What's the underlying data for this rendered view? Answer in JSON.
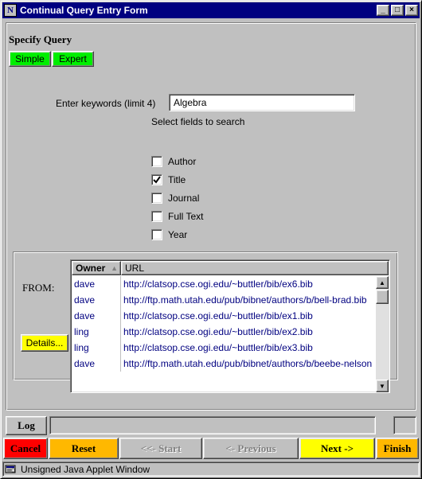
{
  "window": {
    "app_icon": "N",
    "title": "Continual Query Entry Form",
    "controls": {
      "minimize": "_",
      "maximize": "□",
      "close": "×"
    }
  },
  "query": {
    "heading": "Specify Query",
    "simple_label": "Simple",
    "expert_label": "Expert",
    "keywords_label": "Enter keywords (limit 4)",
    "keywords_value": "Algebra",
    "fields_label": "Select fields to search",
    "fields": [
      {
        "label": "Author",
        "checked": false
      },
      {
        "label": "Title",
        "checked": true
      },
      {
        "label": "Journal",
        "checked": false
      },
      {
        "label": "Full Text",
        "checked": false
      },
      {
        "label": "Year",
        "checked": false
      }
    ]
  },
  "from": {
    "label": "FROM:",
    "details_label": "Details...",
    "columns": {
      "owner": "Owner",
      "url": "URL"
    },
    "rows": [
      {
        "owner": "dave",
        "url": "http://clatsop.cse.ogi.edu/~buttler/bib/ex6.bib"
      },
      {
        "owner": "dave",
        "url": "http://ftp.math.utah.edu/pub/bibnet/authors/b/bell-brad.bib"
      },
      {
        "owner": "dave",
        "url": "http://clatsop.cse.ogi.edu/~buttler/bib/ex1.bib"
      },
      {
        "owner": "ling",
        "url": "http://clatsop.cse.ogi.edu/~buttler/bib/ex2.bib"
      },
      {
        "owner": "ling",
        "url": "http://clatsop.cse.ogi.edu/~buttler/bib/ex3.bib"
      },
      {
        "owner": "dave",
        "url": "http://ftp.math.utah.edu/pub/bibnet/authors/b/beebe-nelson"
      }
    ]
  },
  "log": {
    "tab_label": "Log",
    "value": ""
  },
  "nav": {
    "cancel": "Cancel",
    "reset": "Reset",
    "start": "<<- Start",
    "previous": "<- Previous",
    "next": "Next ->",
    "finish": "Finish"
  },
  "status": {
    "text": "Unsigned Java Applet Window"
  },
  "colors": {
    "title_bar": "#000080",
    "mode_button": "#00ee00",
    "details_button": "#ffff00",
    "cancel": "#ff0000",
    "reset": "#ffb800",
    "next": "#ffff00",
    "finish": "#ffb800",
    "table_text": "#000080"
  }
}
